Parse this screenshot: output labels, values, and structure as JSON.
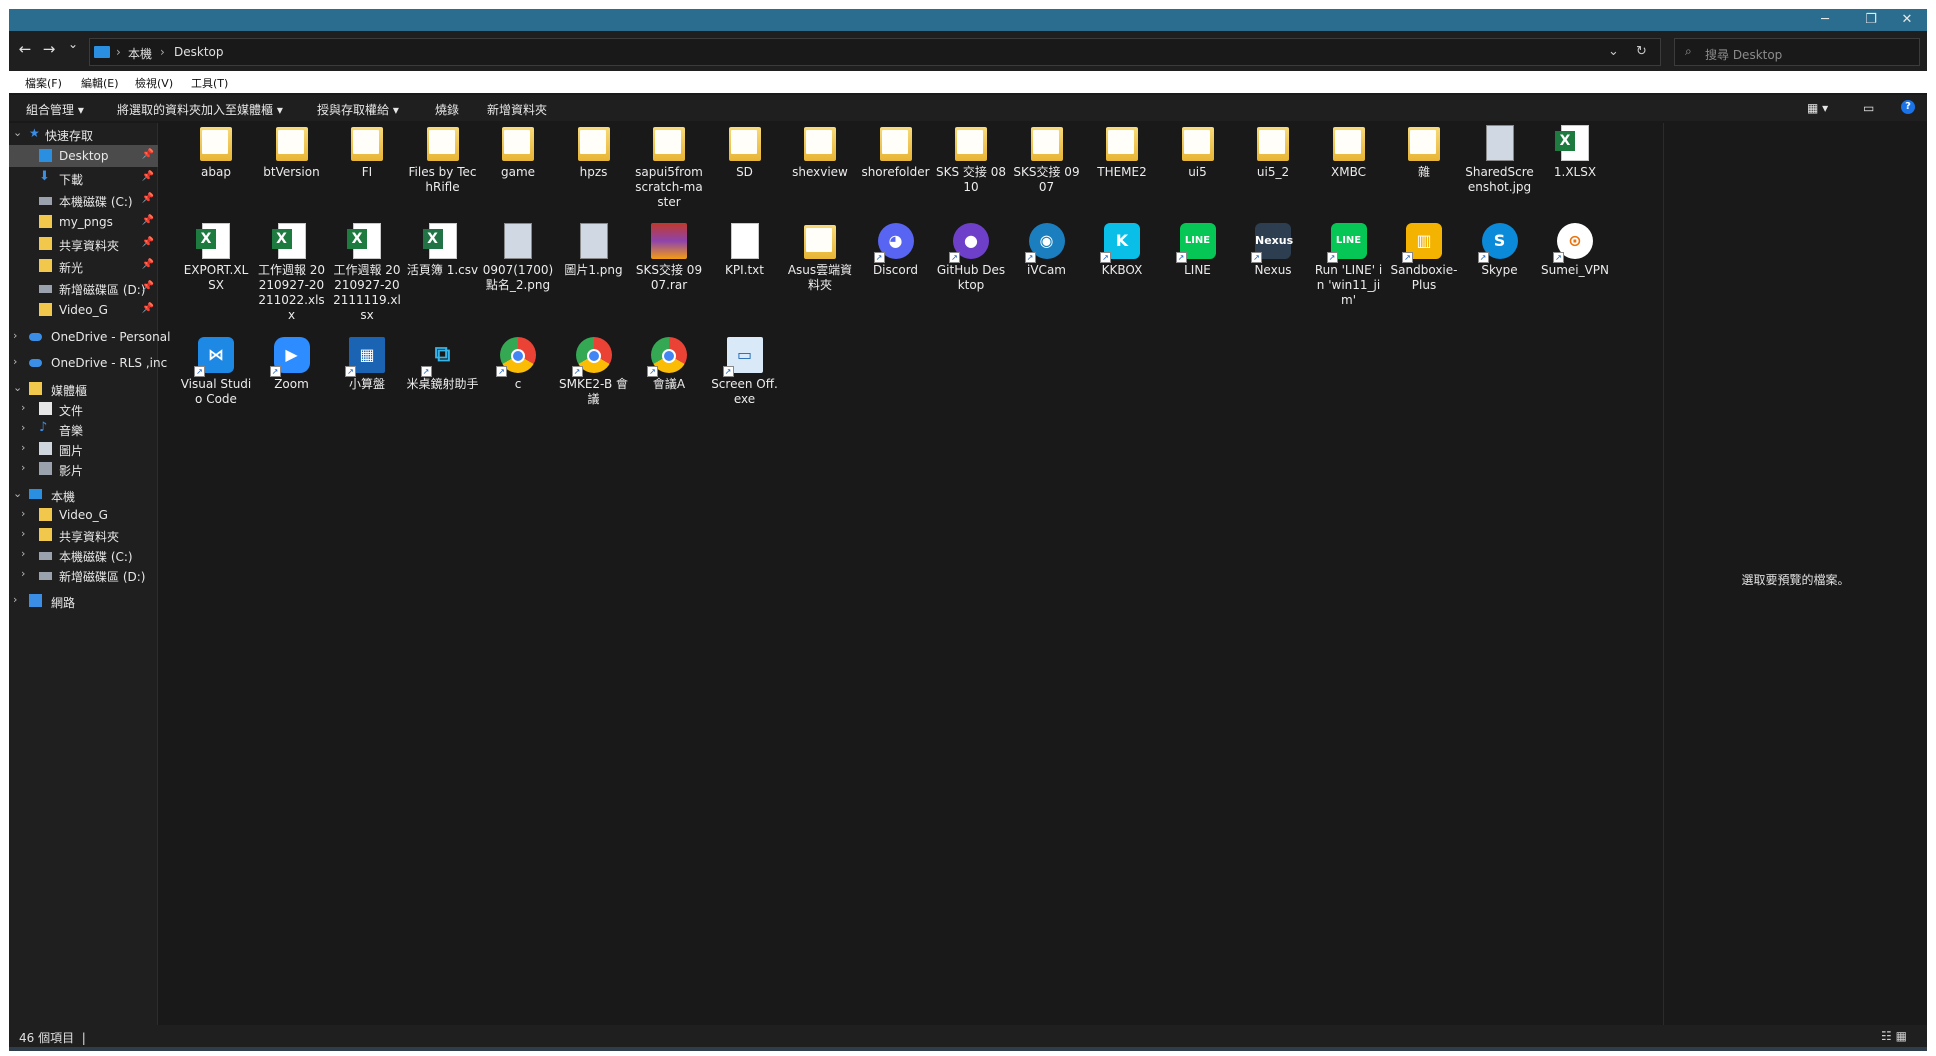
{
  "window": {
    "controls": {
      "minimize": "─",
      "restore": "❐",
      "close": "✕"
    },
    "accent": "#2b6d8e"
  },
  "address": {
    "back": "←",
    "forward": "→",
    "recent": "⌄",
    "segments": [
      "本機",
      "Desktop"
    ],
    "separator": "›",
    "dropdown": "⌄",
    "refresh": "↻"
  },
  "search": {
    "placeholder": "搜尋 Desktop",
    "icon": "⌕"
  },
  "menu": [
    "檔案(F)",
    "編輯(E)",
    "檢視(V)",
    "工具(T)"
  ],
  "commands": [
    "組合管理 ▾",
    "將選取的資料夾加入至媒體櫃 ▾",
    "授與存取權給 ▾",
    "燒錄",
    "新增資料夾"
  ],
  "toolbar_icons": {
    "view": "▦ ▾",
    "preview_pane": "▭",
    "help": "?"
  },
  "nav": {
    "quick_access": "快速存取",
    "quick_items": [
      "Desktop",
      "下載",
      "本機磁碟 (C:)",
      "my_pngs",
      "共享資料夾",
      "新光",
      "新增磁碟區 (D:)",
      "Video_G"
    ],
    "onedrive_personal": "OneDrive - Personal",
    "onedrive_rls": "OneDrive - RLS ,inc",
    "libraries": "媒體櫃",
    "library_items": [
      "文件",
      "音樂",
      "圖片",
      "影片"
    ],
    "this_pc": "本機",
    "pc_items": [
      "Video_G",
      "共享資料夾",
      "本機磁碟 (C:)",
      "新增磁碟區 (D:)"
    ],
    "network": "網路"
  },
  "files": [
    {
      "name": "abap",
      "icon": "folder-icon"
    },
    {
      "name": "btVersion",
      "icon": "folder-icon"
    },
    {
      "name": "FI",
      "icon": "folder-icon"
    },
    {
      "name": "Files by TechRifle",
      "icon": "folder-icon"
    },
    {
      "name": "game",
      "icon": "folder-icon"
    },
    {
      "name": "hpzs",
      "icon": "folder-icon"
    },
    {
      "name": "sapui5fromscratch-master",
      "icon": "folder-icon"
    },
    {
      "name": "SD",
      "icon": "folder-icon"
    },
    {
      "name": "shexview",
      "icon": "folder-icon"
    },
    {
      "name": "shorefolder",
      "icon": "folder-icon"
    },
    {
      "name": "SKS 交接 0810",
      "icon": "folder-icon"
    },
    {
      "name": "SKS交接 0907",
      "icon": "folder-icon"
    },
    {
      "name": "THEME2",
      "icon": "folder-icon"
    },
    {
      "name": "ui5",
      "icon": "folder-icon"
    },
    {
      "name": "ui5_2",
      "icon": "folder-icon"
    },
    {
      "name": "XMBC",
      "icon": "folder-icon"
    },
    {
      "name": "雜",
      "icon": "folder-icon"
    },
    {
      "name": "SharedScreenshot.jpg",
      "icon": "image-icon"
    },
    {
      "name": "1.XLSX",
      "icon": "excel-icon"
    },
    {
      "name": "EXPORT.XLSX",
      "icon": "excel-icon"
    },
    {
      "name": "工作週報 20210927-20211022.xlsx",
      "icon": "excel-icon"
    },
    {
      "name": "工作週報 20210927-202111119.xlsx",
      "icon": "excel-icon"
    },
    {
      "name": "活頁簿 1.csv",
      "icon": "csv-icon"
    },
    {
      "name": "0907(1700)點名_2.png",
      "icon": "image-icon"
    },
    {
      "name": "圖片1.png",
      "icon": "image-icon"
    },
    {
      "name": "SKS交接 0907.rar",
      "icon": "rar-icon"
    },
    {
      "name": "KPI.txt",
      "icon": "text-file-icon"
    },
    {
      "name": "Asus雲端資料夾",
      "icon": "folder-icon"
    },
    {
      "name": "Discord",
      "icon": "discord-icon"
    },
    {
      "name": "GitHub Desktop",
      "icon": "github-icon"
    },
    {
      "name": "iVCam",
      "icon": "ivcam-icon"
    },
    {
      "name": "KKBOX",
      "icon": "kkbox-icon"
    },
    {
      "name": "LINE",
      "icon": "line-icon"
    },
    {
      "name": "Nexus",
      "icon": "nexus-icon"
    },
    {
      "name": "Run 'LINE' in 'win11_jim'",
      "icon": "line-icon"
    },
    {
      "name": "Sandboxie-Plus",
      "icon": "sandboxie-icon"
    },
    {
      "name": "Skype",
      "icon": "skype-icon"
    },
    {
      "name": "Sumei_VPN",
      "icon": "vpn-icon"
    },
    {
      "name": "Visual Studio Code",
      "icon": "vscode-icon"
    },
    {
      "name": "Zoom",
      "icon": "zoom-icon"
    },
    {
      "name": "小算盤",
      "icon": "calculator-icon"
    },
    {
      "name": "米桌鏡射助手",
      "icon": "mirror-icon"
    },
    {
      "name": "c",
      "icon": "chrome-icon"
    },
    {
      "name": "SMKE2-B 會議",
      "icon": "chrome-icon"
    },
    {
      "name": "會議A",
      "icon": "chrome-icon"
    },
    {
      "name": "Screen Off.exe",
      "icon": "monitor-icon"
    }
  ],
  "preview_message": "選取要預覽的檔案。",
  "status": {
    "count": "46 個項目",
    "separator": "|",
    "view_toggle": "☷ ▦"
  }
}
